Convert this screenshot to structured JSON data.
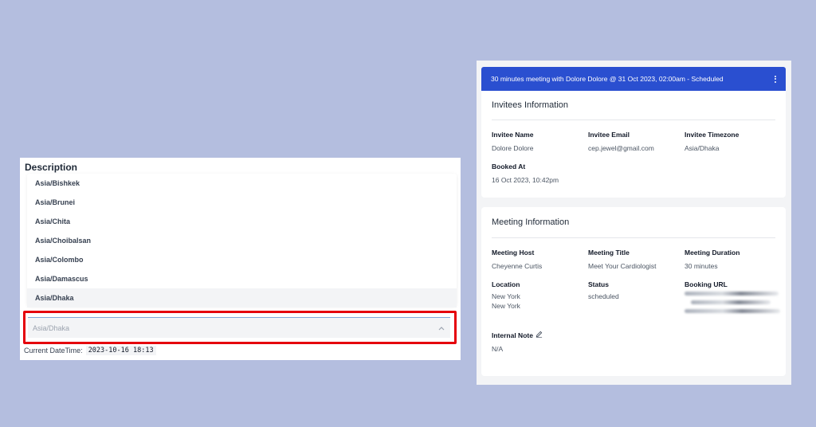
{
  "left": {
    "heading": "Description",
    "timezones": [
      "Asia/Bishkek",
      "Asia/Brunei",
      "Asia/Chita",
      "Asia/Choibalsan",
      "Asia/Colombo",
      "Asia/Damascus",
      "Asia/Dhaka"
    ],
    "active_timezone_index": 6,
    "select": {
      "value": "Asia/Dhaka",
      "chevron_icon": "chevron-up-icon"
    },
    "current_datetime_label": "Current DateTime:",
    "current_datetime_value": "2023-10-16 18:13",
    "highlight_color": "#e5000c"
  },
  "right": {
    "header": {
      "title": "30 minutes meeting with Dolore Dolore @ 31 Oct 2023, 02:00am - Scheduled",
      "menu_icon": "kebab-menu-icon",
      "color": "#2a4fd0"
    },
    "invitees": {
      "title": "Invitees Information",
      "name_label": "Invitee Name",
      "name_value": "Dolore Dolore",
      "email_label": "Invitee Email",
      "email_value": "cep.jewel@gmail.com",
      "timezone_label": "Invitee Timezone",
      "timezone_value": "Asia/Dhaka",
      "booked_label": "Booked At",
      "booked_value": "16 Oct 2023, 10:42pm"
    },
    "meeting": {
      "title": "Meeting Information",
      "host_label": "Meeting Host",
      "host_value": "Cheyenne Curtis",
      "title_label": "Meeting Title",
      "title_value": "Meet Your Cardiologist",
      "duration_label": "Meeting Duration",
      "duration_value": "30 minutes",
      "location_label": "Location",
      "location_line1": "New York",
      "location_line2": "New York",
      "status_label": "Status",
      "status_value": "scheduled",
      "booking_url_label": "Booking URL",
      "note_label": "Internal Note",
      "note_icon": "pencil-icon",
      "note_value": "N/A"
    }
  }
}
